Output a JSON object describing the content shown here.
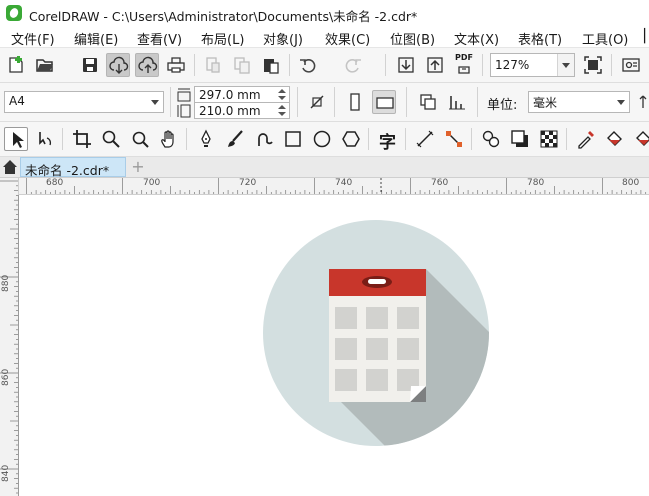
{
  "window": {
    "title": "CorelDRAW - C:\\Users\\Administrator\\Documents\\未命名 -2.cdr*"
  },
  "menu": [
    {
      "label": "文件(F)"
    },
    {
      "label": "编辑(E)"
    },
    {
      "label": "查看(V)"
    },
    {
      "label": "布局(L)"
    },
    {
      "label": "对象(J)"
    },
    {
      "label": "效果(C)"
    },
    {
      "label": "位图(B)"
    },
    {
      "label": "文本(X)"
    },
    {
      "label": "表格(T)"
    },
    {
      "label": "工具(O)"
    }
  ],
  "standard_toolbar": {
    "zoom_value": "127%",
    "pdf_label": "PDF"
  },
  "property_bar": {
    "page_size": "A4",
    "width_value": "297.0 mm",
    "height_value": "210.0 mm",
    "units_label": "单位:",
    "units_value": "毫米"
  },
  "toolbox": {
    "text_tool_label": "字"
  },
  "document_tab": {
    "label": "未命名 -2.cdr*",
    "add_label": "+"
  },
  "rulers": {
    "h_ticks": [
      "680",
      "700",
      "720",
      "740",
      "760",
      "780",
      "800"
    ],
    "v_ticks": [
      "880",
      "860",
      "840"
    ]
  },
  "colors": {
    "circle": "#d3dfe0",
    "shadow": "#b2bbbb",
    "calendar_header": "#c8362b",
    "calendar_body": "#f1f0ec",
    "calendar_cell": "#d2d2cf",
    "accent": "#3aa936"
  }
}
